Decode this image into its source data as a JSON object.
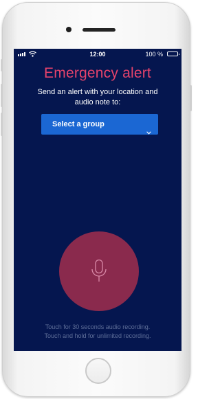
{
  "status_bar": {
    "time": "12:00",
    "battery_percent": "100 %"
  },
  "title": "Emergency alert",
  "subtitle": "Send an alert with your location and audio note to:",
  "group_select": {
    "selected": "Select a group"
  },
  "record_hint": [
    "Touch for 30 seconds audio recording.",
    "Touch and hold for unlimited recording."
  ],
  "colors": {
    "screen_background": "#05164f",
    "title_accent": "#e7436c",
    "select_background": "#1b67d3",
    "record_button": "#8a2a4d",
    "hint_text": "#5f6f99"
  },
  "icons": {
    "select": "chevron-down-icon",
    "record": "microphone-icon"
  }
}
